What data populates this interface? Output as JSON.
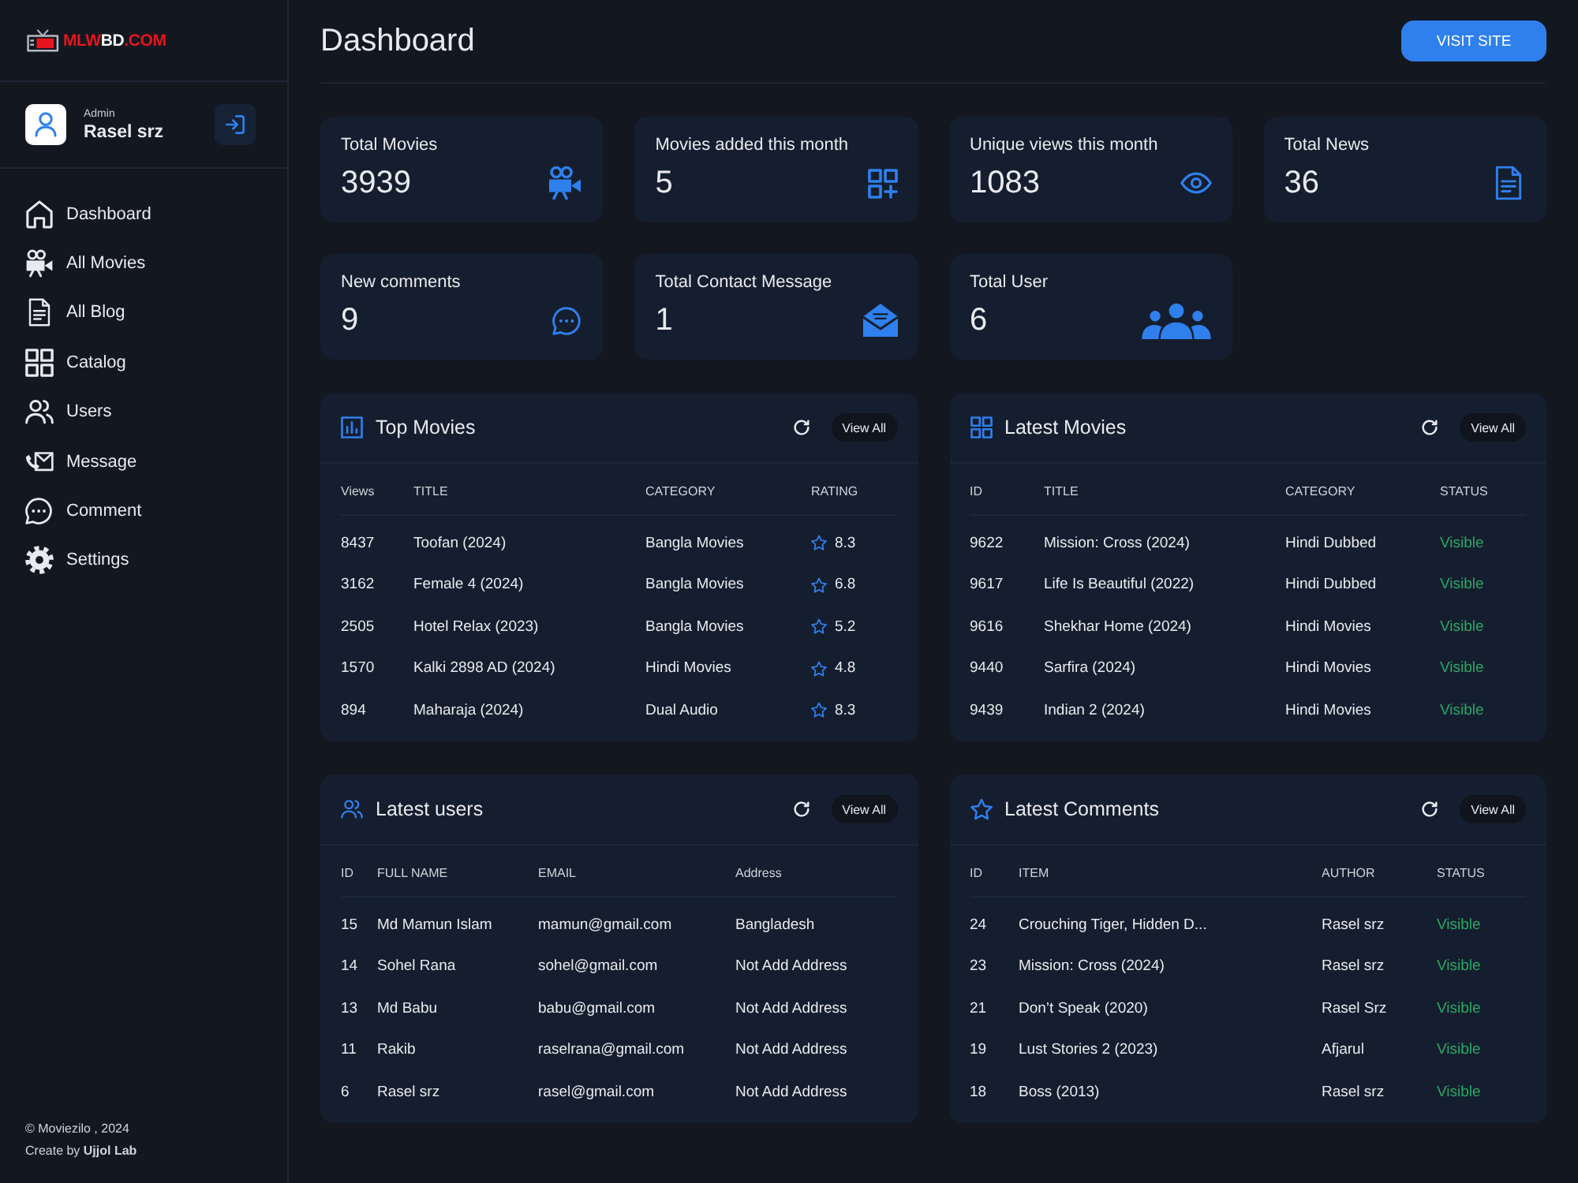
{
  "sidebar": {
    "logo": {
      "parts": [
        {
          "text": "MLW",
          "color": "#e8141c"
        },
        {
          "text": "BD",
          "color": "#ffffff"
        },
        {
          "text": ".COM",
          "color": "#e8141c"
        }
      ]
    },
    "profile": {
      "role": "Admin",
      "name": "Rasel srz"
    },
    "nav": [
      {
        "label": "Dashboard"
      },
      {
        "label": "All Movies"
      },
      {
        "label": "All Blog"
      },
      {
        "label": "Catalog"
      },
      {
        "label": "Users"
      },
      {
        "label": "Message"
      },
      {
        "label": "Comment"
      },
      {
        "label": "Settings"
      }
    ],
    "footer": [
      "© Moviezilo , 2024",
      "Create by **Ujjol Lab**"
    ]
  },
  "header": {
    "title": "Dashboard",
    "button": "VISIT SITE"
  },
  "stats": [
    {
      "label": "Total Movies",
      "value": "3939"
    },
    {
      "label": "Movies added this month",
      "value": "5"
    },
    {
      "label": "Unique views this month",
      "value": "1083"
    },
    {
      "label": "Total News",
      "value": "36"
    },
    {
      "label": "New comments",
      "value": "9"
    },
    {
      "label": "Total Contact Message",
      "value": "1"
    },
    {
      "label": "Total User",
      "value": "6"
    }
  ],
  "panels": [
    {
      "title": "Top Movies",
      "button": "View All",
      "columns": [
        {
          "label": "Views",
          "kind": "text"
        },
        {
          "label": "TITLE",
          "kind": "text"
        },
        {
          "label": "CATEGORY",
          "kind": "text"
        },
        {
          "label": "RATING",
          "kind": "rating"
        }
      ],
      "rows": [
        [
          "8437",
          "Toofan (2024)",
          "Bangla Movies",
          "8.3"
        ],
        [
          "3162",
          "Female 4 (2024)",
          "Bangla Movies",
          "6.8"
        ],
        [
          "2505",
          "Hotel Relax (2023)",
          "Bangla Movies",
          "5.2"
        ],
        [
          "1570",
          "Kalki 2898 AD (2024)",
          "Hindi Movies",
          "4.8"
        ],
        [
          "894",
          "Maharaja (2024)",
          "Dual Audio",
          "8.3"
        ]
      ]
    },
    {
      "title": "Latest Movies",
      "button": "View All",
      "columns": [
        {
          "label": "ID",
          "kind": "text"
        },
        {
          "label": "TITLE",
          "kind": "text"
        },
        {
          "label": "CATEGORY",
          "kind": "text"
        },
        {
          "label": "STATUS",
          "kind": "status"
        }
      ],
      "rows": [
        [
          "9622",
          "Mission: Cross (2024)",
          "Hindi Dubbed",
          "Visible"
        ],
        [
          "9617",
          "Life Is Beautiful (2022)",
          "Hindi Dubbed",
          "Visible"
        ],
        [
          "9616",
          "Shekhar Home (2024)",
          "Hindi Movies",
          "Visible"
        ],
        [
          "9440",
          "Sarfira (2024)",
          "Hindi Movies",
          "Visible"
        ],
        [
          "9439",
          "Indian 2 (2024)",
          "Hindi Movies",
          "Visible"
        ]
      ]
    },
    {
      "title": "Latest users",
      "button": "View All",
      "columns": [
        {
          "label": "ID",
          "kind": "text"
        },
        {
          "label": "FULL NAME",
          "kind": "text"
        },
        {
          "label": "EMAIL",
          "kind": "text"
        },
        {
          "label": "Address",
          "kind": "text"
        }
      ],
      "rows": [
        [
          "15",
          "Md Mamun Islam",
          "mamun@gmail.com",
          "Bangladesh"
        ],
        [
          "14",
          "Sohel Rana",
          "sohel@gmail.com",
          "Not Add Address"
        ],
        [
          "13",
          "Md Babu",
          "babu@gmail.com",
          "Not Add Address"
        ],
        [
          "11",
          "Rakib",
          "raselrana@gmail.com",
          "Not Add Address"
        ],
        [
          "6",
          "Rasel srz",
          "rasel@gmail.com",
          "Not Add Address"
        ]
      ]
    },
    {
      "title": "Latest Comments",
      "button": "View All",
      "columns": [
        {
          "label": "ID",
          "kind": "text"
        },
        {
          "label": "ITEM",
          "kind": "text"
        },
        {
          "label": "AUTHOR",
          "kind": "text"
        },
        {
          "label": "STATUS",
          "kind": "status"
        }
      ],
      "rows": [
        [
          "24",
          "Crouching Tiger, Hidden D...",
          "Rasel srz",
          "Visible"
        ],
        [
          "23",
          "Mission: Cross (2024)",
          "Rasel srz",
          "Visible"
        ],
        [
          "21",
          "Don’t Speak (2020)",
          "Rasel Srz",
          "Visible"
        ],
        [
          "19",
          "Lust Stories 2 (2023)",
          "Afjarul",
          "Visible"
        ],
        [
          "18",
          "Boss (2013)",
          "Rasel srz",
          "Visible"
        ]
      ]
    }
  ]
}
